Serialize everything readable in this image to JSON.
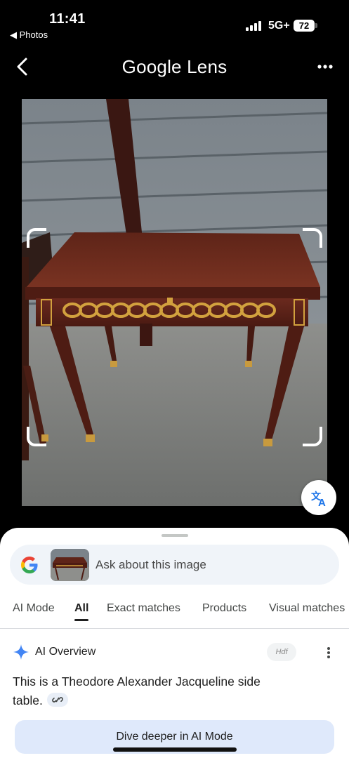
{
  "status_bar": {
    "time": "11:41",
    "back_app": "◀ Photos",
    "network": "5G+",
    "battery": "72"
  },
  "header": {
    "title_part1": "Google",
    "title_part2": " Lens",
    "back_icon": "chevron-left-icon",
    "more_icon": "more-horizontal-icon"
  },
  "photo": {
    "description_icon": "translate-icon"
  },
  "search": {
    "placeholder": "Ask about this image"
  },
  "tabs": [
    {
      "label": "AI Mode"
    },
    {
      "label": "All"
    },
    {
      "label": "Exact matches"
    },
    {
      "label": "Products"
    },
    {
      "label": "Visual matches"
    }
  ],
  "ai_overview": {
    "label": "AI Overview",
    "source_badge": "Hdf",
    "answer": "This is a Theodore Alexander Jacqueline side table."
  },
  "dive_button": {
    "label": "Dive deeper in AI Mode"
  },
  "colors": {
    "background": "#000000",
    "sheet": "#ffffff",
    "search_bar": "#f0f4f9",
    "dive_button": "#dfe9fb",
    "google_blue": "#4285f4",
    "google_red": "#ea4335",
    "google_yellow": "#fbbc05",
    "google_green": "#34a853"
  }
}
